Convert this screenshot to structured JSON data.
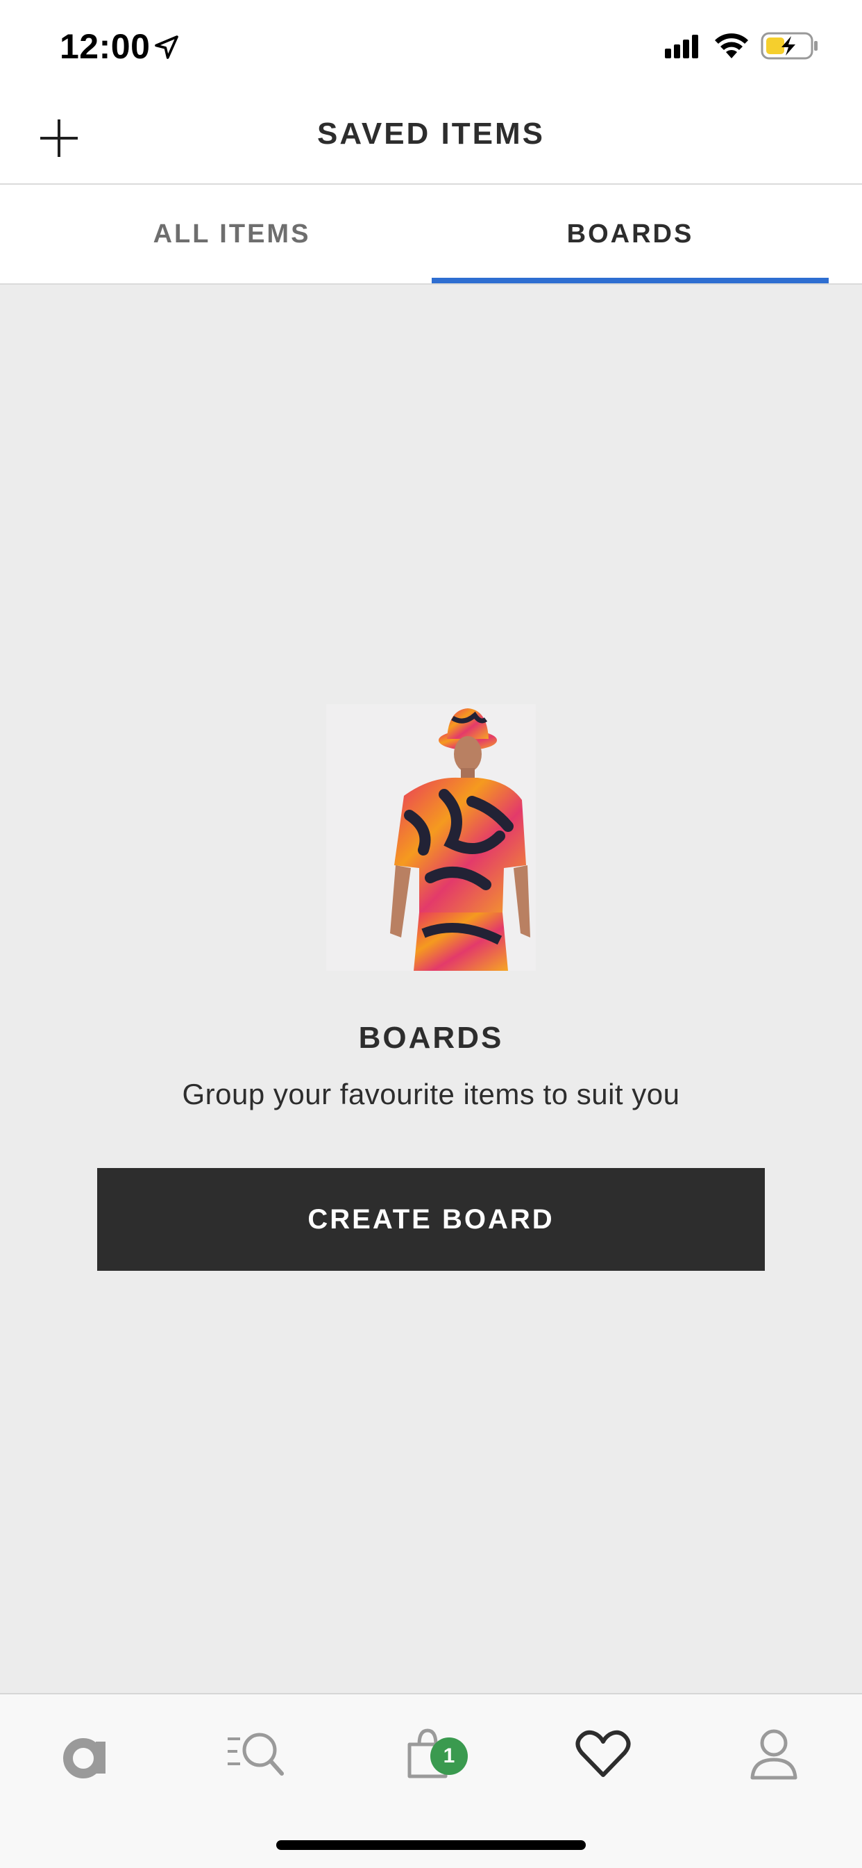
{
  "status_bar": {
    "time": "12:00",
    "icons": [
      "location-arrow-icon",
      "cellular-signal-icon",
      "wifi-icon",
      "battery-charging-icon"
    ]
  },
  "header": {
    "title": "SAVED ITEMS",
    "left_icon": "plus-icon"
  },
  "tabs": [
    {
      "label": "ALL ITEMS",
      "selected": false
    },
    {
      "label": "BOARDS",
      "selected": true
    }
  ],
  "empty_state": {
    "image": "model-in-printed-shirt-and-bucket-hat",
    "heading": "BOARDS",
    "subtitle": "Group your favourite items to suit you",
    "button_label": "CREATE BOARD"
  },
  "bottom_nav": {
    "items": [
      {
        "icon": "home-logo-icon"
      },
      {
        "icon": "search-icon"
      },
      {
        "icon": "bag-icon",
        "badge": "1"
      },
      {
        "icon": "heart-icon",
        "active": true
      },
      {
        "icon": "account-icon"
      }
    ]
  },
  "colors": {
    "accent": "#2e6ed1",
    "button_bg": "#2d2d2d",
    "badge": "#3a9a4f",
    "background": "#ececec"
  }
}
